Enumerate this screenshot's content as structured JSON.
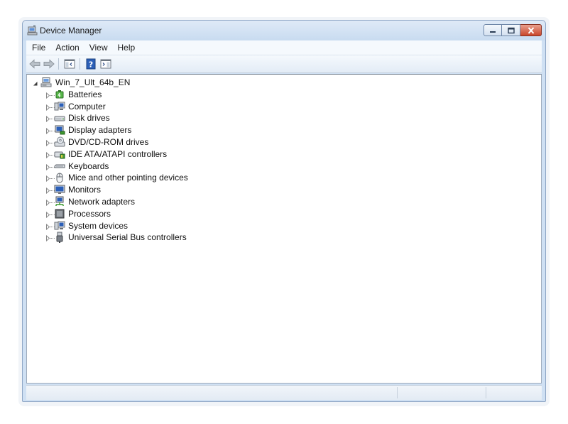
{
  "window": {
    "title": "Device Manager",
    "caption_buttons": [
      "minimize",
      "maximize",
      "close"
    ]
  },
  "menu": {
    "items": [
      "File",
      "Action",
      "View",
      "Help"
    ]
  },
  "toolbar": {
    "buttons": [
      {
        "name": "back",
        "icon": "arrow-left-icon",
        "enabled": false
      },
      {
        "name": "forward",
        "icon": "arrow-right-icon",
        "enabled": false
      },
      {
        "name": "show-hide-console-tree",
        "icon": "console-tree-icon"
      },
      {
        "name": "help",
        "icon": "help-icon"
      },
      {
        "name": "show-hide-action-pane",
        "icon": "action-pane-icon"
      }
    ]
  },
  "tree": {
    "root": {
      "label": "Win_7_Ult_64b_EN",
      "icon": "computer-icon",
      "expanded": true
    },
    "children": [
      {
        "label": "Batteries",
        "icon": "battery-icon"
      },
      {
        "label": "Computer",
        "icon": "computer-icon"
      },
      {
        "label": "Disk drives",
        "icon": "disk-drive-icon"
      },
      {
        "label": "Display adapters",
        "icon": "display-adapter-icon"
      },
      {
        "label": "DVD/CD-ROM drives",
        "icon": "dvd-drive-icon"
      },
      {
        "label": "IDE ATA/ATAPI controllers",
        "icon": "ide-controller-icon"
      },
      {
        "label": "Keyboards",
        "icon": "keyboard-icon"
      },
      {
        "label": "Mice and other pointing devices",
        "icon": "mouse-icon"
      },
      {
        "label": "Monitors",
        "icon": "monitor-icon"
      },
      {
        "label": "Network adapters",
        "icon": "network-adapter-icon"
      },
      {
        "label": "Processors",
        "icon": "processor-icon"
      },
      {
        "label": "System devices",
        "icon": "system-device-icon"
      },
      {
        "label": "Universal Serial Bus controllers",
        "icon": "usb-icon"
      }
    ]
  },
  "statusbar": {
    "panes": [
      "",
      "",
      ""
    ]
  },
  "colors": {
    "frame": "#cfe0f3",
    "close_button": "#c9462b",
    "icon_blue": "#2b5fb8",
    "icon_green": "#3b9a2e"
  }
}
